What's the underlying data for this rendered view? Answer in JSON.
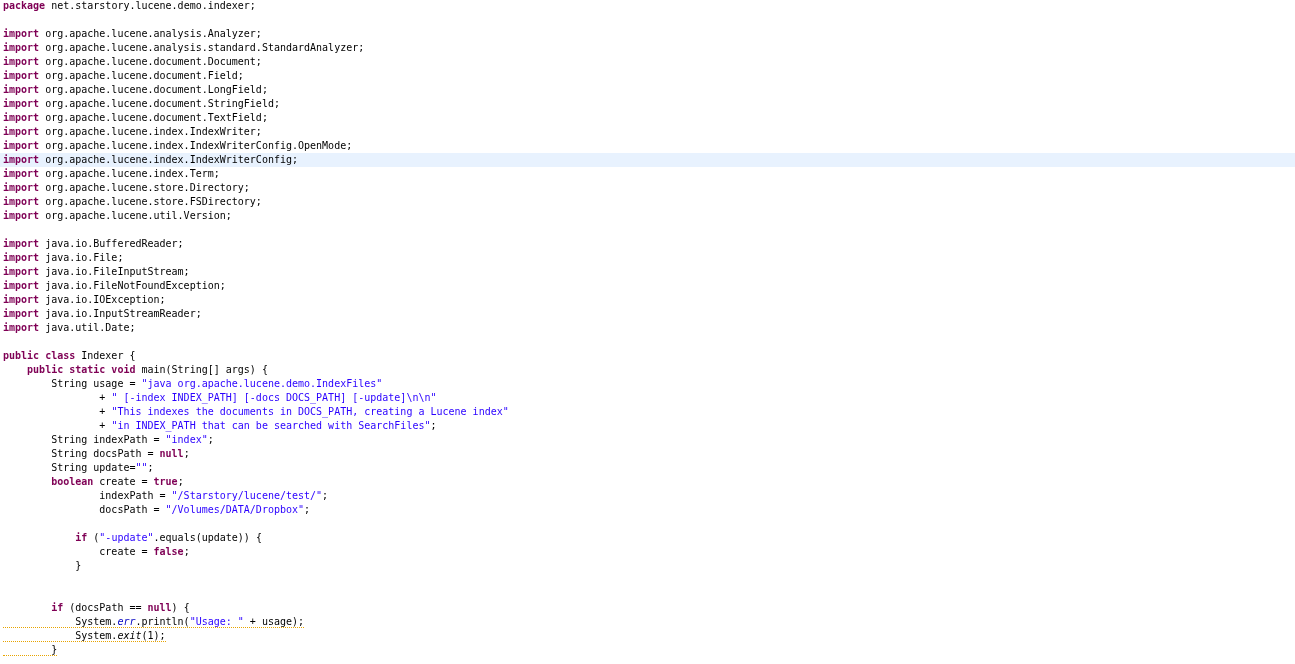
{
  "editor": {
    "lines": [
      {
        "kind": "code",
        "current": false,
        "warning": false,
        "tokens": [
          {
            "kind": "keyword",
            "text": "package"
          },
          {
            "kind": "plain",
            "text": " net.starstory.lucene.demo.indexer;"
          }
        ]
      },
      {
        "kind": "blank"
      },
      {
        "kind": "code",
        "current": false,
        "warning": false,
        "tokens": [
          {
            "kind": "keyword",
            "text": "import"
          },
          {
            "kind": "plain",
            "text": " org.apache.lucene.analysis.Analyzer;"
          }
        ]
      },
      {
        "kind": "code",
        "current": false,
        "warning": false,
        "tokens": [
          {
            "kind": "keyword",
            "text": "import"
          },
          {
            "kind": "plain",
            "text": " org.apache.lucene.analysis.standard.StandardAnalyzer;"
          }
        ]
      },
      {
        "kind": "code",
        "current": false,
        "warning": false,
        "tokens": [
          {
            "kind": "keyword",
            "text": "import"
          },
          {
            "kind": "plain",
            "text": " org.apache.lucene.document.Document;"
          }
        ]
      },
      {
        "kind": "code",
        "current": false,
        "warning": false,
        "tokens": [
          {
            "kind": "keyword",
            "text": "import"
          },
          {
            "kind": "plain",
            "text": " org.apache.lucene.document.Field;"
          }
        ]
      },
      {
        "kind": "code",
        "current": false,
        "warning": false,
        "tokens": [
          {
            "kind": "keyword",
            "text": "import"
          },
          {
            "kind": "plain",
            "text": " org.apache.lucene.document.LongField;"
          }
        ]
      },
      {
        "kind": "code",
        "current": false,
        "warning": false,
        "tokens": [
          {
            "kind": "keyword",
            "text": "import"
          },
          {
            "kind": "plain",
            "text": " org.apache.lucene.document.StringField;"
          }
        ]
      },
      {
        "kind": "code",
        "current": false,
        "warning": false,
        "tokens": [
          {
            "kind": "keyword",
            "text": "import"
          },
          {
            "kind": "plain",
            "text": " org.apache.lucene.document.TextField;"
          }
        ]
      },
      {
        "kind": "code",
        "current": false,
        "warning": false,
        "tokens": [
          {
            "kind": "keyword",
            "text": "import"
          },
          {
            "kind": "plain",
            "text": " org.apache.lucene.index.IndexWriter;"
          }
        ]
      },
      {
        "kind": "code",
        "current": false,
        "warning": false,
        "tokens": [
          {
            "kind": "keyword",
            "text": "import"
          },
          {
            "kind": "plain",
            "text": " org.apache.lucene.index.IndexWriterConfig.OpenMode;"
          }
        ]
      },
      {
        "kind": "code",
        "current": true,
        "warning": false,
        "tokens": [
          {
            "kind": "keyword",
            "text": "import"
          },
          {
            "kind": "plain",
            "text": " org.apache.lucene.index.IndexWriterConfig;"
          }
        ]
      },
      {
        "kind": "code",
        "current": false,
        "warning": false,
        "tokens": [
          {
            "kind": "keyword",
            "text": "import"
          },
          {
            "kind": "plain",
            "text": " org.apache.lucene.index.Term;"
          }
        ]
      },
      {
        "kind": "code",
        "current": false,
        "warning": false,
        "tokens": [
          {
            "kind": "keyword",
            "text": "import"
          },
          {
            "kind": "plain",
            "text": " org.apache.lucene.store.Directory;"
          }
        ]
      },
      {
        "kind": "code",
        "current": false,
        "warning": false,
        "tokens": [
          {
            "kind": "keyword",
            "text": "import"
          },
          {
            "kind": "plain",
            "text": " org.apache.lucene.store.FSDirectory;"
          }
        ]
      },
      {
        "kind": "code",
        "current": false,
        "warning": false,
        "tokens": [
          {
            "kind": "keyword",
            "text": "import"
          },
          {
            "kind": "plain",
            "text": " org.apache.lucene.util.Version;"
          }
        ]
      },
      {
        "kind": "blank"
      },
      {
        "kind": "code",
        "current": false,
        "warning": false,
        "tokens": [
          {
            "kind": "keyword",
            "text": "import"
          },
          {
            "kind": "plain",
            "text": " java.io.BufferedReader;"
          }
        ]
      },
      {
        "kind": "code",
        "current": false,
        "warning": false,
        "tokens": [
          {
            "kind": "keyword",
            "text": "import"
          },
          {
            "kind": "plain",
            "text": " java.io.File;"
          }
        ]
      },
      {
        "kind": "code",
        "current": false,
        "warning": false,
        "tokens": [
          {
            "kind": "keyword",
            "text": "import"
          },
          {
            "kind": "plain",
            "text": " java.io.FileInputStream;"
          }
        ]
      },
      {
        "kind": "code",
        "current": false,
        "warning": false,
        "tokens": [
          {
            "kind": "keyword",
            "text": "import"
          },
          {
            "kind": "plain",
            "text": " java.io.FileNotFoundException;"
          }
        ]
      },
      {
        "kind": "code",
        "current": false,
        "warning": false,
        "tokens": [
          {
            "kind": "keyword",
            "text": "import"
          },
          {
            "kind": "plain",
            "text": " java.io.IOException;"
          }
        ]
      },
      {
        "kind": "code",
        "current": false,
        "warning": false,
        "tokens": [
          {
            "kind": "keyword",
            "text": "import"
          },
          {
            "kind": "plain",
            "text": " java.io.InputStreamReader;"
          }
        ]
      },
      {
        "kind": "code",
        "current": false,
        "warning": false,
        "tokens": [
          {
            "kind": "keyword",
            "text": "import"
          },
          {
            "kind": "plain",
            "text": " java.util.Date;"
          }
        ]
      },
      {
        "kind": "blank"
      },
      {
        "kind": "code",
        "current": false,
        "warning": false,
        "tokens": [
          {
            "kind": "keyword",
            "text": "public class"
          },
          {
            "kind": "plain",
            "text": " Indexer {"
          }
        ]
      },
      {
        "kind": "code",
        "current": false,
        "warning": false,
        "tokens": [
          {
            "kind": "keyword",
            "text": "    public static void"
          },
          {
            "kind": "plain",
            "text": " main(String[] args) {"
          }
        ]
      },
      {
        "kind": "code",
        "current": false,
        "warning": false,
        "tokens": [
          {
            "kind": "plain",
            "text": "        String usage = "
          },
          {
            "kind": "string",
            "text": "\"java org.apache.lucene.demo.IndexFiles\""
          }
        ]
      },
      {
        "kind": "code",
        "current": false,
        "warning": false,
        "tokens": [
          {
            "kind": "plain",
            "text": "                + "
          },
          {
            "kind": "string",
            "text": "\" [-index INDEX_PATH] [-docs DOCS_PATH] [-update]\\n\\n\""
          }
        ]
      },
      {
        "kind": "code",
        "current": false,
        "warning": false,
        "tokens": [
          {
            "kind": "plain",
            "text": "                + "
          },
          {
            "kind": "string",
            "text": "\"This indexes the documents in DOCS_PATH, creating a Lucene index\""
          }
        ]
      },
      {
        "kind": "code",
        "current": false,
        "warning": false,
        "tokens": [
          {
            "kind": "plain",
            "text": "                + "
          },
          {
            "kind": "string",
            "text": "\"in INDEX_PATH that can be searched with SearchFiles\""
          },
          {
            "kind": "plain",
            "text": ";"
          }
        ]
      },
      {
        "kind": "code",
        "current": false,
        "warning": false,
        "tokens": [
          {
            "kind": "plain",
            "text": "        String indexPath = "
          },
          {
            "kind": "string",
            "text": "\"index\""
          },
          {
            "kind": "plain",
            "text": ";"
          }
        ]
      },
      {
        "kind": "code",
        "current": false,
        "warning": false,
        "tokens": [
          {
            "kind": "plain",
            "text": "        String docsPath = "
          },
          {
            "kind": "keyword",
            "text": "null"
          },
          {
            "kind": "plain",
            "text": ";"
          }
        ]
      },
      {
        "kind": "code",
        "current": false,
        "warning": false,
        "tokens": [
          {
            "kind": "plain",
            "text": "        String update="
          },
          {
            "kind": "string",
            "text": "\"\""
          },
          {
            "kind": "plain",
            "text": ";"
          }
        ]
      },
      {
        "kind": "code",
        "current": false,
        "warning": false,
        "tokens": [
          {
            "kind": "keyword",
            "text": "        boolean"
          },
          {
            "kind": "plain",
            "text": " create = "
          },
          {
            "kind": "keyword",
            "text": "true"
          },
          {
            "kind": "plain",
            "text": ";"
          }
        ]
      },
      {
        "kind": "code",
        "current": false,
        "warning": false,
        "tokens": [
          {
            "kind": "plain",
            "text": "                indexPath = "
          },
          {
            "kind": "string",
            "text": "\"/Starstory/lucene/test/\""
          },
          {
            "kind": "plain",
            "text": ";"
          }
        ]
      },
      {
        "kind": "code",
        "current": false,
        "warning": false,
        "tokens": [
          {
            "kind": "plain",
            "text": "                docsPath = "
          },
          {
            "kind": "string",
            "text": "\"/Volumes/DATA/Dropbox\""
          },
          {
            "kind": "plain",
            "text": ";"
          }
        ]
      },
      {
        "kind": "blank"
      },
      {
        "kind": "code",
        "current": false,
        "warning": false,
        "tokens": [
          {
            "kind": "keyword",
            "text": "            if"
          },
          {
            "kind": "plain",
            "text": " ("
          },
          {
            "kind": "string",
            "text": "\"-update\""
          },
          {
            "kind": "plain",
            "text": ".equals(update)) {"
          }
        ]
      },
      {
        "kind": "code",
        "current": false,
        "warning": false,
        "tokens": [
          {
            "kind": "plain",
            "text": "                create = "
          },
          {
            "kind": "keyword",
            "text": "false"
          },
          {
            "kind": "plain",
            "text": ";"
          }
        ]
      },
      {
        "kind": "code",
        "current": false,
        "warning": false,
        "tokens": [
          {
            "kind": "plain",
            "text": "            }"
          }
        ]
      },
      {
        "kind": "blank"
      },
      {
        "kind": "blank"
      },
      {
        "kind": "code",
        "current": false,
        "warning": false,
        "tokens": [
          {
            "kind": "keyword",
            "text": "        if"
          },
          {
            "kind": "plain",
            "text": " (docsPath == "
          },
          {
            "kind": "keyword",
            "text": "null"
          },
          {
            "kind": "plain",
            "text": ") {"
          }
        ]
      },
      {
        "kind": "code",
        "current": false,
        "warning": true,
        "tokens": [
          {
            "kind": "plain",
            "text": "            System."
          },
          {
            "kind": "static_field",
            "text": "err"
          },
          {
            "kind": "plain",
            "text": ".println("
          },
          {
            "kind": "string",
            "text": "\"Usage: \""
          },
          {
            "kind": "plain",
            "text": " + usage);"
          }
        ]
      },
      {
        "kind": "code",
        "current": false,
        "warning": true,
        "tokens": [
          {
            "kind": "plain",
            "text": "            System."
          },
          {
            "kind": "static_method",
            "text": "exit"
          },
          {
            "kind": "plain",
            "text": "(1);"
          }
        ]
      },
      {
        "kind": "code",
        "current": false,
        "warning": true,
        "tokens": [
          {
            "kind": "plain",
            "text": "        }"
          }
        ]
      }
    ]
  }
}
